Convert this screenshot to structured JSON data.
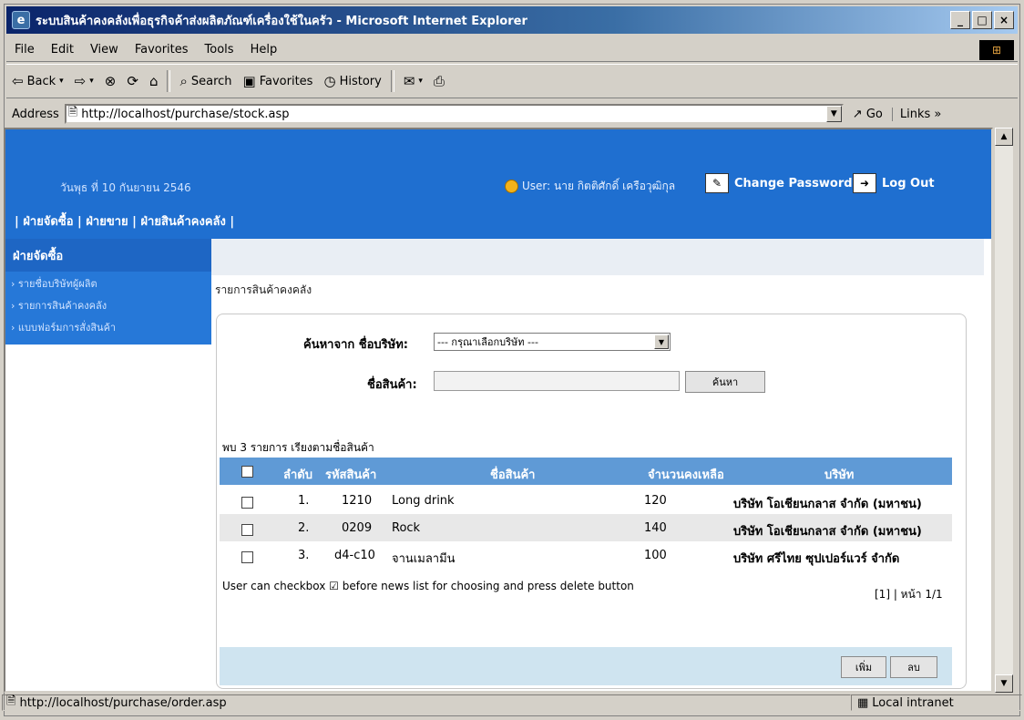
{
  "window": {
    "title": "ระบบสินค้าคงคลังเพื่อธุรกิจค้าส่งผลิตภัณฑ์เครื่องใช้ในครัว - Microsoft Internet Explorer"
  },
  "menu": [
    "File",
    "Edit",
    "View",
    "Favorites",
    "Tools",
    "Help"
  ],
  "toolbar": {
    "back": "Back",
    "search": "Search",
    "favorites": "Favorites",
    "history": "History"
  },
  "address": {
    "label": "Address",
    "url": "http://localhost/purchase/stock.asp",
    "go": "Go",
    "links": "Links"
  },
  "header": {
    "date": "วันพุธ ที่ 10 กันยายน 2546",
    "user": "User: นาย กิตติศักดิ์ เครือวุฒิกุล",
    "change_password": "Change Password",
    "logout": "Log Out",
    "nav": "| ฝ่ายจัดซื้อ | ฝ่ายขาย | ฝ่ายสินค้าคงคลัง |"
  },
  "sidebar": {
    "heading": "ฝ่ายจัดซื้อ",
    "items": [
      "รายชื่อบริษัทผู้ผลิต",
      "รายการสินค้าคงคลัง",
      "แบบฟอร์มการสั่งสินค้า"
    ]
  },
  "page_title": "รายการสินค้าคงคลัง",
  "search": {
    "company_label": "ค้นหาจาก ชื่อบริษัท:",
    "company_select": "--- กรุณาเลือกบริษัท ---",
    "product_label": "ชื่อสินค้า:",
    "product_value": "",
    "button": "ค้นหา"
  },
  "result_summary": "พบ 3 รายการ เรียงตามชื่อสินค้า",
  "table": {
    "headers": {
      "no": "ลำดับ",
      "code": "รหัสสินค้า",
      "name": "ชื่อสินค้า",
      "qty": "จำนวนคงเหลือ",
      "company": "บริษัท"
    },
    "rows": [
      {
        "no": "1.",
        "code": "1210",
        "name": "Long drink",
        "qty": "120",
        "company": "บริษัท โอเชียนกลาส จำกัด (มหาชน)"
      },
      {
        "no": "2.",
        "code": "0209",
        "name": "Rock",
        "qty": "140",
        "company": "บริษัท โอเชียนกลาส จำกัด (มหาชน)"
      },
      {
        "no": "3.",
        "code": "d4-c10",
        "name": "จานเมลามีน",
        "qty": "100",
        "company": "บริษัท ศรีไทย ซุปเปอร์แวร์ จำกัด"
      }
    ]
  },
  "note": "User can checkbox ☑ before news list for choosing and press delete button",
  "pager": "[1] | หน้า 1/1",
  "buttons": {
    "add": "เพิ่ม",
    "delete": "ลบ"
  },
  "status": {
    "url": "http://localhost/purchase/order.asp",
    "zone": "Local intranet"
  }
}
